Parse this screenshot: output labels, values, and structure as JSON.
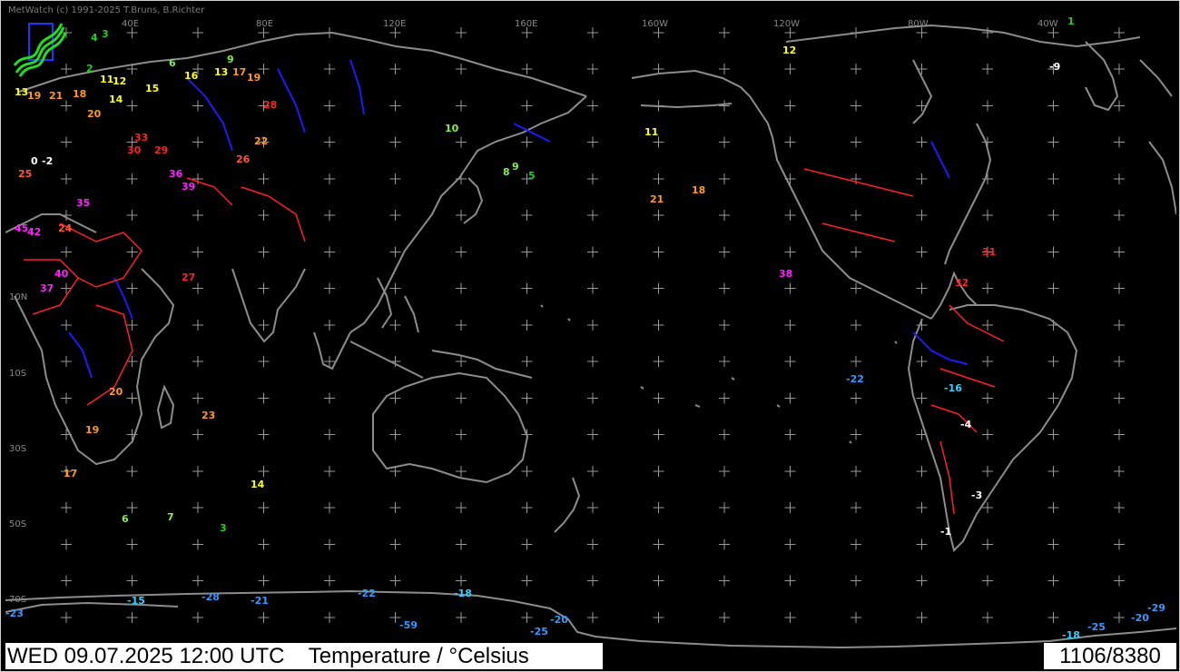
{
  "header": {
    "copyright": "MetWatch  (c) 1991-2025 T.Bruns, B.Richter"
  },
  "map": {
    "longitude_labels": [
      "40E",
      "80E",
      "120E",
      "160E",
      "160W",
      "120W",
      "80W",
      "40W"
    ],
    "latitude_labels": [
      "10N",
      "10S",
      "30S",
      "50S",
      "70S"
    ],
    "colors": {
      "background": "#000000",
      "coastline": "#8c8c8c",
      "river_blue": "#1a1aff",
      "border_red": "#ff2020",
      "grid": "#9a9a9a"
    },
    "color_scale": [
      {
        "range": "<= -20",
        "color": "#3399ff"
      },
      {
        "range": "-19..-10",
        "color": "#33ccff"
      },
      {
        "range": "-9..0",
        "color": "#ffffff"
      },
      {
        "range": "1..5",
        "color": "#22cc22"
      },
      {
        "range": "6..10",
        "color": "#88ee44"
      },
      {
        "range": "11..16",
        "color": "#ffff22"
      },
      {
        "range": "17..23",
        "color": "#ff9922"
      },
      {
        "range": "24..26",
        "color": "#ff5533"
      },
      {
        "range": "27..33",
        "color": "#ff2222"
      },
      {
        "range": ">= 34",
        "color": "#ff22ff"
      }
    ],
    "temperature_observations": [
      {
        "id": "a1",
        "t": "4"
      },
      {
        "id": "a2",
        "t": "3"
      },
      {
        "id": "a3",
        "t": "6"
      },
      {
        "id": "a4",
        "t": "9"
      },
      {
        "id": "a5",
        "t": "16"
      },
      {
        "id": "a6",
        "t": "2"
      },
      {
        "id": "a7",
        "t": "11"
      },
      {
        "id": "a8",
        "t": "12"
      },
      {
        "id": "a9",
        "t": "15"
      },
      {
        "id": "a10",
        "t": "13"
      },
      {
        "id": "a11",
        "t": "17"
      },
      {
        "id": "a12",
        "t": "19"
      },
      {
        "id": "a13",
        "t": "13"
      },
      {
        "id": "a14",
        "t": "19"
      },
      {
        "id": "a15",
        "t": "21"
      },
      {
        "id": "a16",
        "t": "18"
      },
      {
        "id": "a17",
        "t": "14"
      },
      {
        "id": "a18",
        "t": "20"
      },
      {
        "id": "a19",
        "t": "0"
      },
      {
        "id": "a20",
        "t": "-2"
      },
      {
        "id": "a21",
        "t": "25"
      },
      {
        "id": "a22",
        "t": "30"
      },
      {
        "id": "a23",
        "t": "29"
      },
      {
        "id": "a24",
        "t": "33"
      },
      {
        "id": "a25",
        "t": "36"
      },
      {
        "id": "a26",
        "t": "35"
      },
      {
        "id": "a27",
        "t": "45"
      },
      {
        "id": "a28",
        "t": "42"
      },
      {
        "id": "a29",
        "t": "39"
      },
      {
        "id": "a30",
        "t": "40"
      },
      {
        "id": "a31",
        "t": "37"
      },
      {
        "id": "a32",
        "t": "27"
      },
      {
        "id": "a33",
        "t": "24"
      },
      {
        "id": "a34",
        "t": "28"
      },
      {
        "id": "a35",
        "t": "22"
      },
      {
        "id": "a36",
        "t": "26"
      },
      {
        "id": "a37",
        "t": "23"
      },
      {
        "id": "a38",
        "t": "19"
      },
      {
        "id": "a39",
        "t": "20"
      },
      {
        "id": "a40",
        "t": "17"
      },
      {
        "id": "a41",
        "t": "14"
      },
      {
        "id": "a42",
        "t": "6"
      },
      {
        "id": "a43",
        "t": "7"
      },
      {
        "id": "a44",
        "t": "3"
      },
      {
        "id": "a45",
        "t": "-15"
      },
      {
        "id": "a46",
        "t": "-28"
      },
      {
        "id": "a47",
        "t": "-21"
      },
      {
        "id": "a48",
        "t": "-22"
      },
      {
        "id": "a49",
        "t": "-18"
      },
      {
        "id": "a50",
        "t": "-59"
      },
      {
        "id": "a51",
        "t": "-25"
      },
      {
        "id": "a52",
        "t": "-20"
      },
      {
        "id": "a53",
        "t": "-23"
      },
      {
        "id": "a54",
        "t": "10"
      },
      {
        "id": "a55",
        "t": "9"
      },
      {
        "id": "a56",
        "t": "8"
      },
      {
        "id": "a57",
        "t": "5"
      },
      {
        "id": "a58",
        "t": "38"
      },
      {
        "id": "a59",
        "t": "-22"
      },
      {
        "id": "a60",
        "t": "-18"
      },
      {
        "id": "a61",
        "t": "-25"
      },
      {
        "id": "a62",
        "t": "-20"
      },
      {
        "id": "a63",
        "t": "-29"
      },
      {
        "id": "a64",
        "t": "-1"
      },
      {
        "id": "a65",
        "t": "-3"
      },
      {
        "id": "a66",
        "t": "-9"
      },
      {
        "id": "a67",
        "t": "1"
      },
      {
        "id": "a68",
        "t": "-4"
      },
      {
        "id": "a69",
        "t": "-16"
      },
      {
        "id": "a70",
        "t": "31"
      },
      {
        "id": "a71",
        "t": "32"
      },
      {
        "id": "a72",
        "t": "21"
      },
      {
        "id": "a73",
        "t": "11"
      },
      {
        "id": "a74",
        "t": "12"
      },
      {
        "id": "a75",
        "t": "18"
      }
    ]
  },
  "footer": {
    "datetime": "WED 09.07.2025 12:00 UTC",
    "parameter": "Temperature / °Celsius",
    "station_count": "1106/8380"
  }
}
